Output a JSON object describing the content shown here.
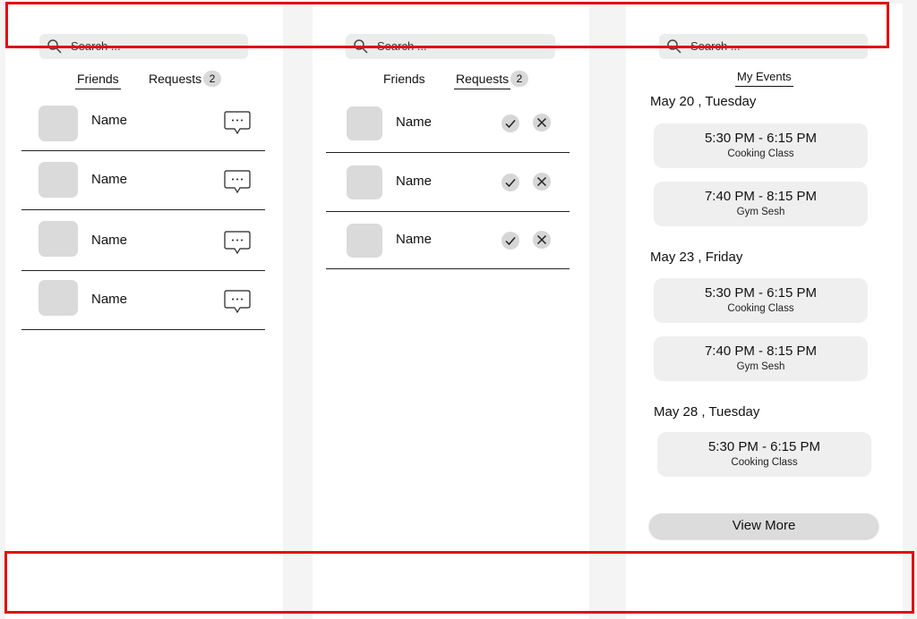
{
  "friends_panel": {
    "search_placeholder": "Search ...",
    "tabs": {
      "friends": "Friends",
      "requests": "Requests",
      "requests_count": "2"
    },
    "rows": [
      {
        "name": "Name"
      },
      {
        "name": "Name"
      },
      {
        "name": "Name"
      },
      {
        "name": "Name"
      }
    ]
  },
  "requests_panel": {
    "search_placeholder": "Search ...",
    "tabs": {
      "friends": "Friends",
      "requests": "Requests",
      "requests_count": "2"
    },
    "rows": [
      {
        "name": "Name"
      },
      {
        "name": "Name"
      },
      {
        "name": "Name"
      }
    ]
  },
  "events_panel": {
    "search_placeholder": "Search ...",
    "tab": "My Events",
    "days": [
      {
        "date": "May 20 , Tuesday",
        "events": [
          {
            "time": "5:30 PM - 6:15 PM",
            "title": "Cooking Class"
          },
          {
            "time": "7:40 PM - 8:15 PM",
            "title": "Gym Sesh"
          }
        ]
      },
      {
        "date": "May 23 , Friday",
        "events": [
          {
            "time": "5:30 PM - 6:15 PM",
            "title": "Cooking Class"
          },
          {
            "time": "7:40 PM - 8:15 PM",
            "title": "Gym Sesh"
          }
        ]
      },
      {
        "date": "May 28 , Tuesday",
        "events": [
          {
            "time": "5:30 PM - 6:15 PM",
            "title": "Cooking Class"
          }
        ]
      }
    ],
    "view_more": "View More"
  },
  "colors": {
    "annotation": "#e01010",
    "card": "#efefef",
    "avatar": "#dadada"
  }
}
